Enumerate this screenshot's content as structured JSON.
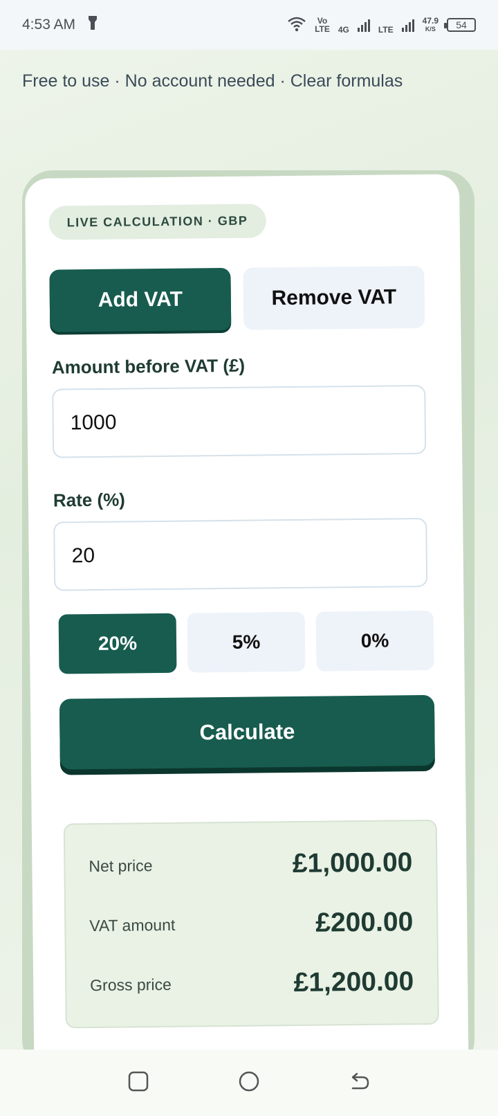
{
  "status_bar": {
    "time": "4:53 AM",
    "net_speed": "47.9",
    "net_unit": "K/S",
    "battery": "54",
    "volte_top": "Vo",
    "volte_bottom": "LTE",
    "sim1": "4G",
    "sim2": "LTE"
  },
  "tagline": "Free to use · No account needed · Clear formulas",
  "card": {
    "badge": "LIVE CALCULATION · GBP",
    "modes": [
      {
        "label": "Add VAT",
        "selected": true
      },
      {
        "label": "Remove VAT",
        "selected": false
      }
    ],
    "amount_label": "Amount before VAT (£)",
    "amount_value": "1000",
    "rate_label": "Rate (%)",
    "rate_value": "20",
    "rate_presets": [
      {
        "label": "20%",
        "selected": true
      },
      {
        "label": "5%",
        "selected": false
      },
      {
        "label": "0%",
        "selected": false
      }
    ],
    "calculate_label": "Calculate",
    "results": [
      {
        "label": "Net price",
        "value": "£1,000.00"
      },
      {
        "label": "VAT amount",
        "value": "£200.00"
      },
      {
        "label": "Gross price",
        "value": "£1,200.00"
      }
    ]
  },
  "colors": {
    "primary": "#175c4f",
    "secondary_button": "#eef3fa",
    "results_bg": "#e9f2e4"
  }
}
